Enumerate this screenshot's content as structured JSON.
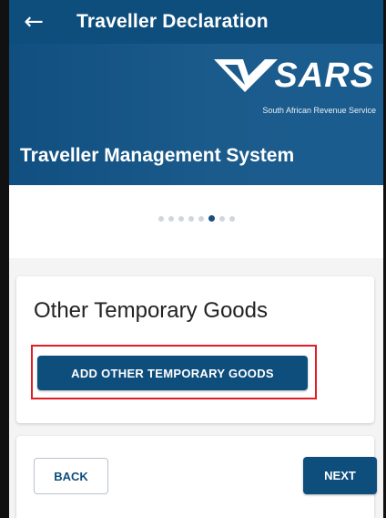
{
  "appbar": {
    "back_icon": "arrow-left-icon",
    "back_glyph": "←",
    "title": "Traveller Declaration"
  },
  "banner": {
    "logo_text": "SARS",
    "logo_subtitle": "South African Revenue Service",
    "title": "Traveller Management System"
  },
  "stepper": {
    "total_steps": 8,
    "active_step": 6
  },
  "card": {
    "title": "Other Temporary Goods",
    "add_button_label": "ADD OTHER TEMPORARY GOODS"
  },
  "nav": {
    "back_label": "BACK",
    "next_label": "NEXT"
  },
  "colors": {
    "primary": "#0e4e7d",
    "highlight": "#e31c24",
    "dot_inactive": "#cfd6dc",
    "dot_active": "#1a4f7c"
  }
}
